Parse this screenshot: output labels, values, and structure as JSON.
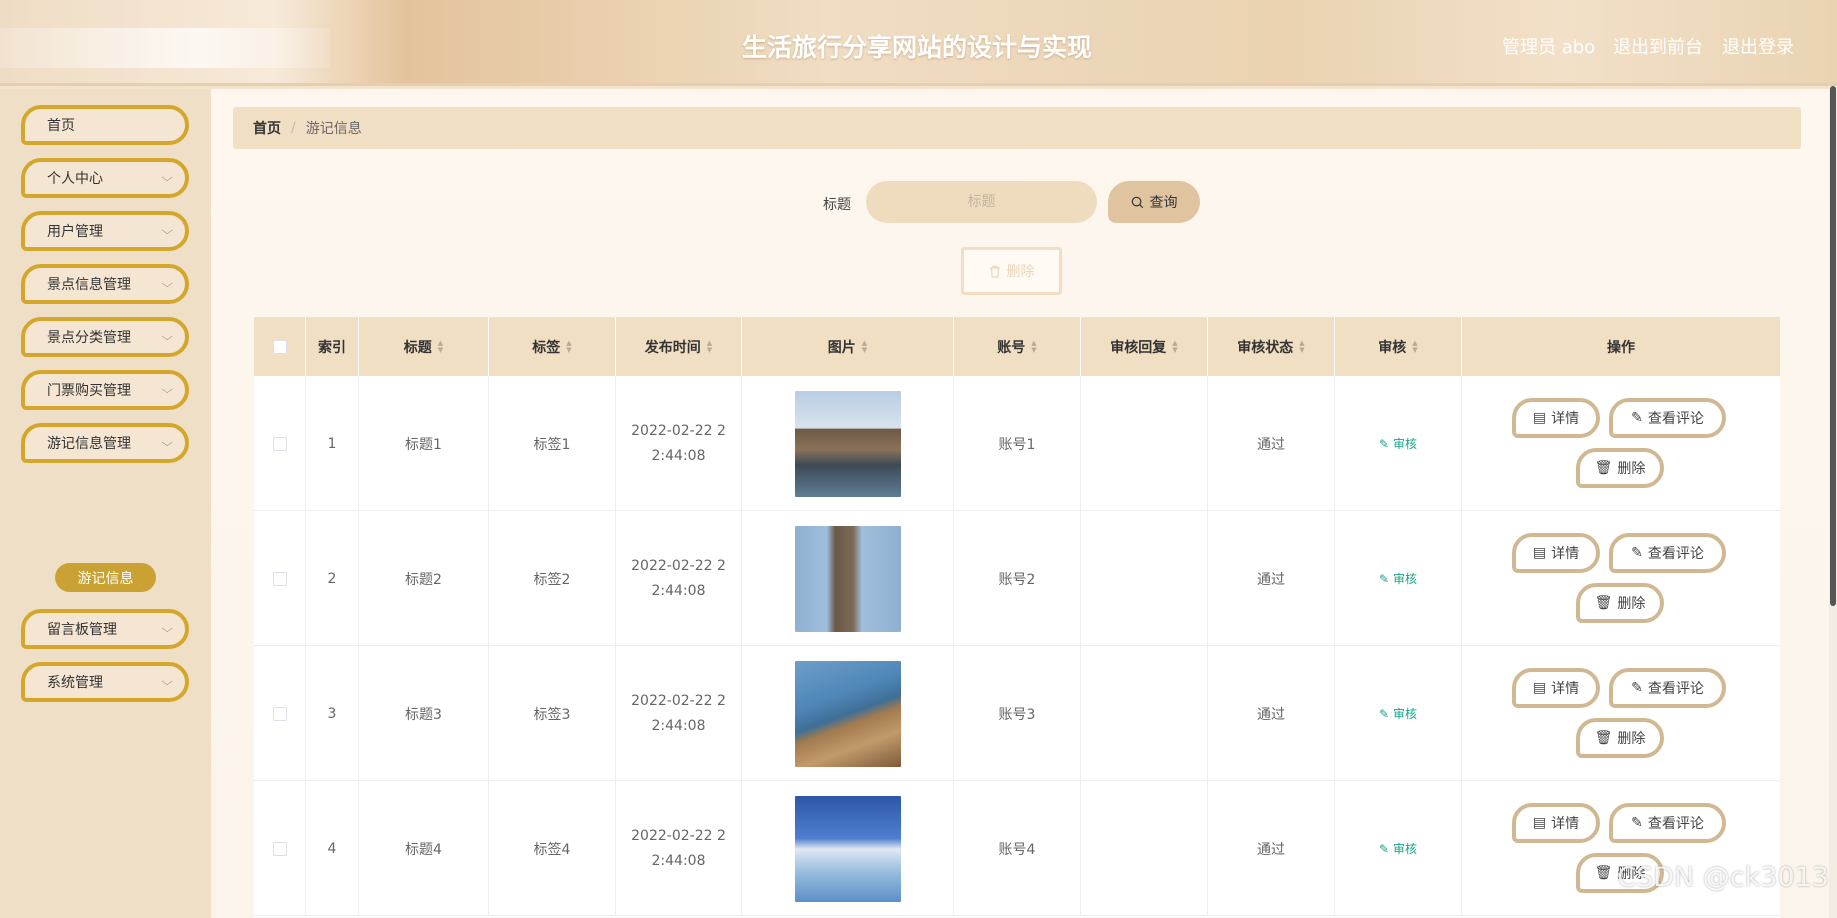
{
  "header": {
    "title": "生活旅行分享网站的设计与实现",
    "admin": "管理员 abo",
    "front_link": "退出到前台",
    "logout_link": "退出登录"
  },
  "sidebar": {
    "items": [
      {
        "label": "首页",
        "has_arrow": false
      },
      {
        "label": "个人中心",
        "has_arrow": true
      },
      {
        "label": "用户管理",
        "has_arrow": true
      },
      {
        "label": "景点信息管理",
        "has_arrow": true
      },
      {
        "label": "景点分类管理",
        "has_arrow": true
      },
      {
        "label": "门票购买管理",
        "has_arrow": true
      },
      {
        "label": "游记信息管理",
        "has_arrow": true
      },
      {
        "label": "留言板管理",
        "has_arrow": true
      },
      {
        "label": "系统管理",
        "has_arrow": true
      }
    ],
    "active_sub": "游记信息"
  },
  "breadcrumb": {
    "home": "首页",
    "separator": "/",
    "current": "游记信息"
  },
  "search": {
    "label": "标题",
    "placeholder": "标题",
    "query_button": "查询"
  },
  "batch_delete_label": "删除",
  "table": {
    "columns": [
      "索引",
      "标题",
      "标签",
      "发布时间",
      "图片",
      "账号",
      "审核回复",
      "审核状态",
      "审核",
      "操作"
    ],
    "rows": [
      {
        "index": "1",
        "title": "标题1",
        "tag": "标签1",
        "time_line1": "2022-02-22 2",
        "time_line2": "2:44:08",
        "account": "账号1",
        "reply": "",
        "status": "通过",
        "audit": "审核"
      },
      {
        "index": "2",
        "title": "标题2",
        "tag": "标签2",
        "time_line1": "2022-02-22 2",
        "time_line2": "2:44:08",
        "account": "账号2",
        "reply": "",
        "status": "通过",
        "audit": "审核"
      },
      {
        "index": "3",
        "title": "标题3",
        "tag": "标签3",
        "time_line1": "2022-02-22 2",
        "time_line2": "2:44:08",
        "account": "账号3",
        "reply": "",
        "status": "通过",
        "audit": "审核"
      },
      {
        "index": "4",
        "title": "标题4",
        "tag": "标签4",
        "time_line1": "2022-02-22 2",
        "time_line2": "2:44:08",
        "account": "账号4",
        "reply": "",
        "status": "通过",
        "audit": "审核"
      }
    ],
    "actions": {
      "detail": "详情",
      "comments": "查看评论",
      "delete": "删除"
    }
  },
  "watermark": "CSDN @ck3013",
  "colors": {
    "accent_gold": "#d4a72c",
    "header_bg": "#ead2b2",
    "table_header": "#f1dfc4",
    "audit_green": "#1aa38a"
  }
}
